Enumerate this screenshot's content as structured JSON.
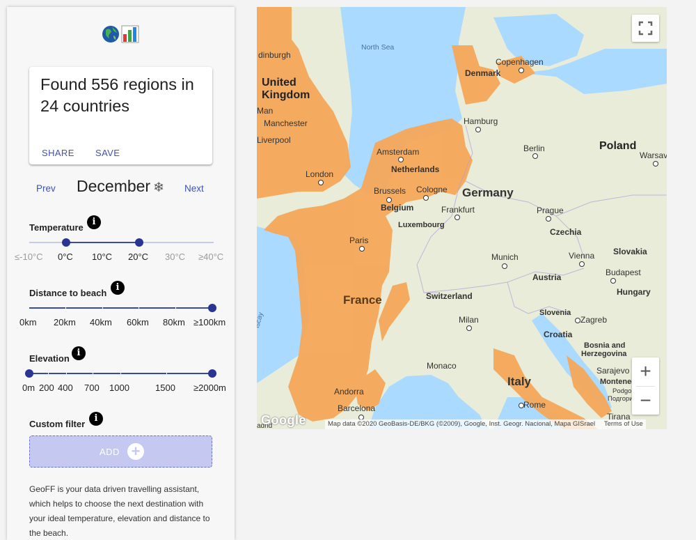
{
  "sidebar": {
    "logo_icons": [
      "globe-icon",
      "bar-chart-icon"
    ],
    "result_card": {
      "title": "Found 556 regions in 24 countries",
      "share_label": "SHARE",
      "save_label": "SAVE"
    },
    "month_nav": {
      "prev_label": "Prev",
      "month": "December",
      "month_icon": "❄",
      "next_label": "Next"
    },
    "temperature": {
      "label": "Temperature",
      "info": "i",
      "ticks": [
        "≤-10°C",
        "0°C",
        "10°C",
        "20°C",
        "30°C",
        "≥40°C"
      ],
      "selected_range": [
        "0°C",
        "20°C"
      ]
    },
    "distance": {
      "label": "Distance to beach",
      "info": "i",
      "ticks": [
        "0km",
        "20km",
        "40km",
        "60km",
        "80km",
        "≥100km"
      ],
      "selected_range": [
        "≥100km"
      ]
    },
    "elevation": {
      "label": "Elevation",
      "info": "i",
      "ticks": [
        "0m",
        "200",
        "400",
        "700",
        "1000",
        "1500",
        "≥2000m"
      ],
      "selected_range": [
        "0m",
        "≥2000m"
      ]
    },
    "custom_filter": {
      "label": "Custom filter",
      "info": "i",
      "add_label": "ADD",
      "add_icon": "+"
    },
    "description": "GeoFF is your data driven travelling assistant, which helps to choose the next destination with your ideal temperature, elevation and distance to the beach."
  },
  "map": {
    "labels": {
      "edinburgh": "dinburgh",
      "north_sea": "North Sea",
      "copenhagen": "Copenhagen",
      "denmark": "Denmark",
      "united_kingdom_1": "United",
      "united_kingdom_2": "Kingdom",
      "isle_of_man": "Man",
      "manchester": "Manchester",
      "liverpool": "Liverpool",
      "hamburg": "Hamburg",
      "poland": "Poland",
      "warsaw": "Warsav",
      "berlin": "Berlin",
      "amsterdam": "Amsterdam",
      "netherlands": "Netherlands",
      "london": "London",
      "germany": "Germany",
      "brussels": "Brussels",
      "cologne": "Cologne",
      "belgium": "Belgium",
      "frankfurt": "Frankfurt",
      "prague": "Prague",
      "luxembourg": "Luxembourg",
      "czechia": "Czechia",
      "paris": "Paris",
      "slovakia": "Slovakia",
      "vienna": "Vienna",
      "munich": "Munich",
      "budapest": "Budapest",
      "austria": "Austria",
      "hungary": "Hungary",
      "switzerland": "Switzerland",
      "france": "France",
      "biscay": "iscay",
      "slovenia": "Slovenia",
      "zagreb": "Zagreb",
      "milan": "Milan",
      "croatia": "Croatia",
      "bosnia_1": "Bosnia and",
      "bosnia_2": "Herzegovina",
      "monaco": "Monaco",
      "sarajevo": "Sarajevo",
      "italy": "Italy",
      "andorra": "Andorra",
      "montenegro": "Monteneg",
      "podgorica_1": "Podgorica",
      "podgorica_2": "Подгорица",
      "rome": "Rome",
      "barcelona": "Barcelona",
      "madrid": "adrid",
      "tirana": "Tirana"
    },
    "google_logo": "Google",
    "attribution": "Map data ©2020 GeoBasis-DE/BKG (©2009), Google, Inst. Geogr. Nacional, Mapa GISrael",
    "terms": "Terms of Use",
    "fullscreen_icon": "fullscreen-icon",
    "zoom_in": "+",
    "zoom_out": "−",
    "highlight_color": "#f5a85a",
    "water_color": "#aadaff",
    "land_color": "#e8ecd8"
  }
}
